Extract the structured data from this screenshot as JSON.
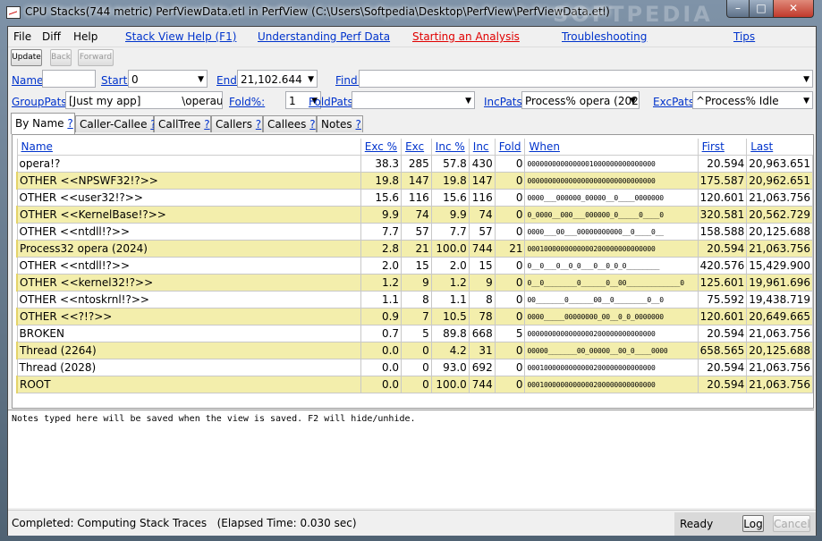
{
  "window": {
    "title": "CPU Stacks(744 metric) PerfViewData.etl in PerfView (C:\\Users\\Softpedia\\Desktop\\PerfView\\PerfViewData.etl)",
    "watermark": "SOFTPEDIA",
    "min_glyph": "–",
    "max_glyph": "□",
    "close_glyph": "✕"
  },
  "menu": {
    "file": "File",
    "diff": "Diff",
    "help": "Help",
    "stack_view_help": "Stack View Help (F1)",
    "understanding": "Understanding Perf Data",
    "starting": "Starting an Analysis",
    "troubleshooting": "Troubleshooting",
    "tips": "Tips"
  },
  "toolbar": {
    "update": "Update",
    "back": "Back",
    "forward": "Forward"
  },
  "filters": {
    "name_label": "Name:",
    "name_value": "",
    "start_label": "Start:",
    "start_value": "0",
    "end_label": "End:",
    "end_value": "21,102.644",
    "find_label": "Find:",
    "find_value": "",
    "grouppats_label": "GroupPats:",
    "grouppats_value": "[Just my app]            \\operaus",
    "fold_label": "Fold%:",
    "fold_value": "1",
    "foldpats_label": "FoldPats:",
    "foldpats_value": "",
    "incpats_label": "IncPats:",
    "incpats_value": "Process% opera (202",
    "excpats_label": "ExcPats:",
    "excpats_value": "^Process% Idle"
  },
  "tabs": [
    {
      "label": "By Name",
      "q": "?"
    },
    {
      "label": "Caller-Callee",
      "q": "?"
    },
    {
      "label": "CallTree",
      "q": "?"
    },
    {
      "label": "Callers",
      "q": "?"
    },
    {
      "label": "Callees",
      "q": "?"
    },
    {
      "label": "Notes",
      "q": "?"
    }
  ],
  "table": {
    "headers": [
      "Name",
      "Exc %",
      "Exc",
      "Inc %",
      "Inc",
      "Fold",
      "When",
      "First",
      "Last"
    ],
    "rows": [
      {
        "name": "opera!?",
        "exc_pct": "38.3",
        "exc": "285",
        "inc_pct": "57.8",
        "inc": "430",
        "fold": "0",
        "when": "0000000000000001000000000000000",
        "first": "20.594",
        "last": "20,963.651"
      },
      {
        "name": "OTHER <<NPSWF32!?>>",
        "exc_pct": "19.8",
        "exc": "147",
        "inc_pct": "19.8",
        "inc": "147",
        "fold": "0",
        "when": "0000000000000000000000000000000",
        "first": "175.587",
        "last": "20,962.651"
      },
      {
        "name": "OTHER <<user32!?>>",
        "exc_pct": "15.6",
        "exc": "116",
        "inc_pct": "15.6",
        "inc": "116",
        "fold": "0",
        "when": "0000___000000_00000__0____0000000",
        "first": "120.601",
        "last": "21,063.756"
      },
      {
        "name": "OTHER <<KernelBase!?>>",
        "exc_pct": "9.9",
        "exc": "74",
        "inc_pct": "9.9",
        "inc": "74",
        "fold": "0",
        "when": "0_0000__000___000000_0_____0____0",
        "first": "320.581",
        "last": "20,562.729"
      },
      {
        "name": "OTHER <<ntdll!?>>",
        "exc_pct": "7.7",
        "exc": "57",
        "inc_pct": "7.7",
        "inc": "57",
        "fold": "0",
        "when": "0000___00___00000000000__0____0__",
        "first": "158.588",
        "last": "20,125.688"
      },
      {
        "name": "Process32 opera (2024)",
        "exc_pct": "2.8",
        "exc": "21",
        "inc_pct": "100.0",
        "inc": "744",
        "fold": "21",
        "when": "0001000000000000200000000000000",
        "first": "20.594",
        "last": "21,063.756"
      },
      {
        "name": "OTHER <<ntdll!?>>",
        "exc_pct": "2.0",
        "exc": "15",
        "inc_pct": "2.0",
        "inc": "15",
        "fold": "0",
        "when": "0__0___0__0_0___0__0_0_0________",
        "first": "420.576",
        "last": "15,429.900"
      },
      {
        "name": "OTHER <<kernel32!?>>",
        "exc_pct": "1.2",
        "exc": "9",
        "inc_pct": "1.2",
        "inc": "9",
        "fold": "0",
        "when": "0__0________0______0__00_____________0",
        "first": "125.601",
        "last": "19,961.696"
      },
      {
        "name": "OTHER <<ntoskrnl!?>>",
        "exc_pct": "1.1",
        "exc": "8",
        "inc_pct": "1.1",
        "inc": "8",
        "fold": "0",
        "when": "00_______0______00__0________0__0",
        "first": "75.592",
        "last": "19,438.719"
      },
      {
        "name": "OTHER <<?!?>>",
        "exc_pct": "0.9",
        "exc": "7",
        "inc_pct": "10.5",
        "inc": "78",
        "fold": "0",
        "when": "0000_____00000000_00__0_0_0000000",
        "first": "120.601",
        "last": "20,649.665"
      },
      {
        "name": "BROKEN",
        "exc_pct": "0.7",
        "exc": "5",
        "inc_pct": "89.8",
        "inc": "668",
        "fold": "5",
        "when": "0000000000000000200000000000000",
        "first": "20.594",
        "last": "21,063.756"
      },
      {
        "name": "Thread (2264)",
        "exc_pct": "0.0",
        "exc": "0",
        "inc_pct": "4.2",
        "inc": "31",
        "fold": "0",
        "when": "00000_______00_00000__00_0____0000",
        "first": "658.565",
        "last": "20,125.688"
      },
      {
        "name": "Thread (2028)",
        "exc_pct": "0.0",
        "exc": "0",
        "inc_pct": "93.0",
        "inc": "692",
        "fold": "0",
        "when": "0001000000000000200000000000000",
        "first": "20.594",
        "last": "21,063.756"
      },
      {
        "name": "ROOT",
        "exc_pct": "0.0",
        "exc": "0",
        "inc_pct": "100.0",
        "inc": "744",
        "fold": "0",
        "when": "0001000000000000200000000000000",
        "first": "20.594",
        "last": "21,063.756"
      }
    ]
  },
  "notes": "Notes typed here will be saved when the view is saved. F2 will hide/unhide.",
  "status": {
    "message": "Completed: Computing Stack Traces   (Elapsed Time: 0.030 sec)",
    "ready": "Ready",
    "log": "Log",
    "cancel": "Cancel"
  },
  "colors": {
    "highlight_row": "#f3eeac",
    "link": "#0033cc",
    "link_red": "#e00000"
  }
}
